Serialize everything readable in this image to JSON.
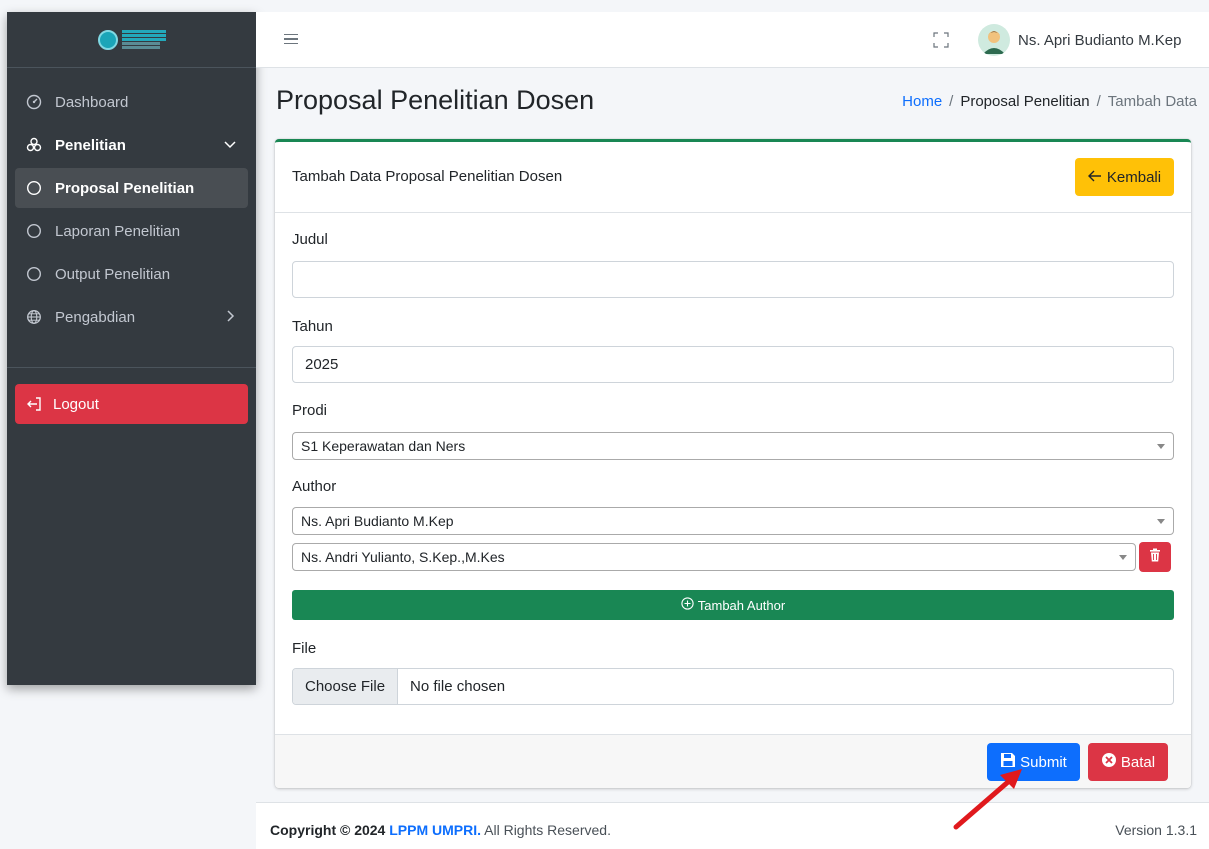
{
  "sidebar": {
    "items": [
      {
        "label": "Dashboard"
      },
      {
        "label": "Penelitian"
      },
      {
        "label": "Proposal Penelitian"
      },
      {
        "label": "Laporan Penelitian"
      },
      {
        "label": "Output Penelitian"
      },
      {
        "label": "Pengabdian"
      }
    ],
    "logout_label": "Logout"
  },
  "header": {
    "user_name": "Ns. Apri Budianto M.Kep"
  },
  "page": {
    "title": "Proposal Penelitian Dosen",
    "breadcrumb": [
      "Home",
      "/",
      "Proposal Penelitian",
      "/",
      "Tambah Data"
    ]
  },
  "card": {
    "title": "Tambah Data Proposal Penelitian Dosen",
    "back_label": "Kembali"
  },
  "form": {
    "judul_label": "Judul",
    "judul_value": "",
    "tahun_label": "Tahun",
    "tahun_value": "2025",
    "prodi_label": "Prodi",
    "prodi_value": "S1 Keperawatan dan Ners",
    "author_label": "Author",
    "authors": [
      "Ns. Apri Budianto M.Kep",
      "Ns. Andri Yulianto, S.Kep.,M.Kes"
    ],
    "add_author_label": "Tambah Author",
    "file_label": "File",
    "file_button": "Choose File",
    "file_status": "No file chosen",
    "submit_label": "Submit",
    "cancel_label": "Batal"
  },
  "footer": {
    "copyright_prefix": "Copyright © 2024",
    "org_link": "LPPM UMPRI.",
    "rights": "All Rights Reserved.",
    "version": "Version 1.3.1"
  },
  "colors": {
    "sidebar_bg": "#343a40",
    "card_accent": "#198754",
    "primary": "#0d6efd",
    "danger": "#dc3545",
    "warning": "#ffc107"
  }
}
